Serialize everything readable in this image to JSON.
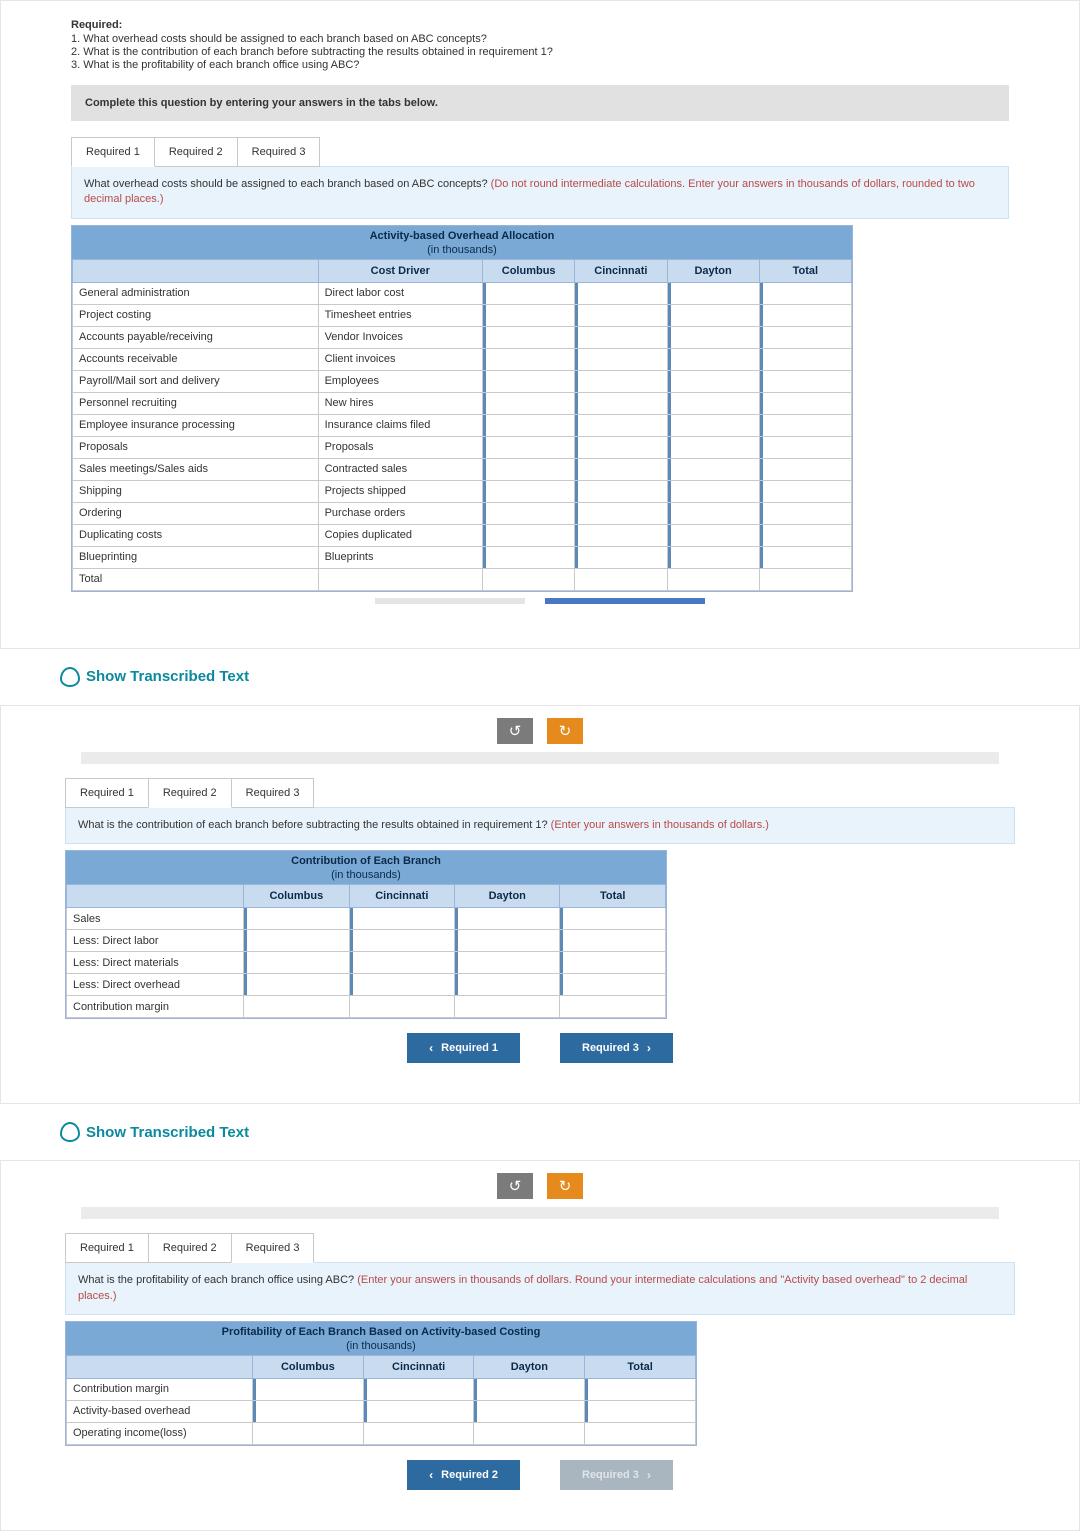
{
  "required_heading": "Required:",
  "required_items": [
    "1. What overhead costs should be assigned to each branch based on ABC concepts?",
    "2. What is the contribution of each branch before subtracting the results obtained in requirement 1?",
    "3. What is the profitability of each branch office using ABC?"
  ],
  "complete_instr": "Complete this question by entering your answers in the tabs below.",
  "tabs": [
    "Required 1",
    "Required 2",
    "Required 3"
  ],
  "show_text": "Show Transcribed Text",
  "s1": {
    "prompt_black": "What overhead costs should be assigned to each branch based on ABC concepts? ",
    "prompt_red": "(Do not round intermediate calculations. Enter your answers in thousands of dollars, rounded to two decimal places.)",
    "table_title": "Activity-based Overhead Allocation",
    "table_sub": "(in thousands)",
    "headers": [
      "",
      "Cost Driver",
      "Columbus",
      "Cincinnati",
      "Dayton",
      "Total"
    ],
    "rows": [
      [
        "General administration",
        "Direct labor cost"
      ],
      [
        "Project costing",
        "Timesheet entries"
      ],
      [
        "Accounts payable/receiving",
        "Vendor Invoices"
      ],
      [
        "Accounts receivable",
        "Client invoices"
      ],
      [
        "Payroll/Mail sort and delivery",
        "Employees"
      ],
      [
        "Personnel recruiting",
        "New hires"
      ],
      [
        "Employee insurance processing",
        "Insurance claims filed"
      ],
      [
        "Proposals",
        "Proposals"
      ],
      [
        "Sales meetings/Sales aids",
        "Contracted sales"
      ],
      [
        "Shipping",
        "Projects shipped"
      ],
      [
        "Ordering",
        "Purchase orders"
      ],
      [
        "Duplicating costs",
        "Copies duplicated"
      ],
      [
        "Blueprinting",
        "Blueprints"
      ],
      [
        "Total",
        ""
      ]
    ]
  },
  "s2": {
    "prompt_black": "What is the contribution of each branch before subtracting the results obtained in requirement 1? ",
    "prompt_red": "(Enter your answers in thousands of dollars.)",
    "table_title": "Contribution of Each Branch",
    "table_sub": "(in thousands)",
    "headers": [
      "",
      "Columbus",
      "Cincinnati",
      "Dayton",
      "Total"
    ],
    "rows": [
      "Sales",
      "Less: Direct labor",
      "Less: Direct materials",
      "Less: Direct overhead",
      "Contribution margin"
    ],
    "nav_prev": "Required 1",
    "nav_next": "Required 3"
  },
  "s3": {
    "prompt_black": "What is the profitability of each branch office using ABC? ",
    "prompt_red": "(Enter your answers in thousands of dollars. Round your intermediate calculations and \"Activity based overhead\" to 2 decimal places.)",
    "table_title": "Profitability of Each Branch Based on Activity-based Costing",
    "table_sub": "(in thousands)",
    "headers": [
      "",
      "Columbus",
      "Cincinnati",
      "Dayton",
      "Total"
    ],
    "rows": [
      "Contribution margin",
      "Activity-based overhead",
      "Operating income(loss)"
    ],
    "nav_prev": "Required 2",
    "nav_next": "Required 3"
  }
}
